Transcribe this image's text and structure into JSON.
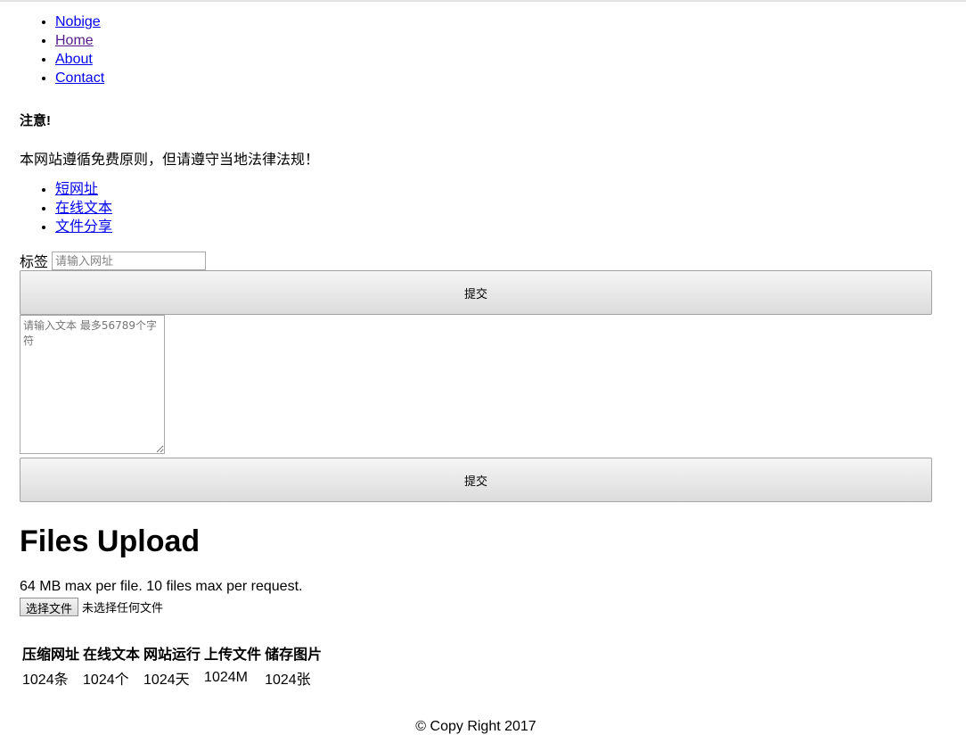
{
  "nav": {
    "items": [
      {
        "label": "Nobige"
      },
      {
        "label": "Home"
      },
      {
        "label": "About"
      },
      {
        "label": "Contact"
      }
    ]
  },
  "notice": {
    "title": "注意!",
    "text": "本网站遵循免费原则，但请遵守当地法律法规！"
  },
  "tools": {
    "items": [
      {
        "label": "短网址"
      },
      {
        "label": "在线文本"
      },
      {
        "label": "文件分享"
      }
    ]
  },
  "shorturl": {
    "tag_label": "标签",
    "placeholder": "请输入网址",
    "value": "",
    "submit_label": "提交"
  },
  "text": {
    "placeholder": "请输入文本 最多56789个字符",
    "value": "",
    "submit_label": "提交"
  },
  "upload": {
    "title": "Files Upload",
    "limit_text": "64 MB max per file. 10 files max per request.",
    "choose_label": "选择文件",
    "status_text": "未选择任何文件"
  },
  "stats": {
    "headers": [
      "压缩网址",
      "在线文本",
      "网站运行",
      "上传文件",
      "储存图片"
    ],
    "values": [
      "1024条",
      "1024个",
      "1024天",
      "1024M",
      "1024张"
    ]
  },
  "footer": {
    "text": "© Copy Right 2017"
  }
}
